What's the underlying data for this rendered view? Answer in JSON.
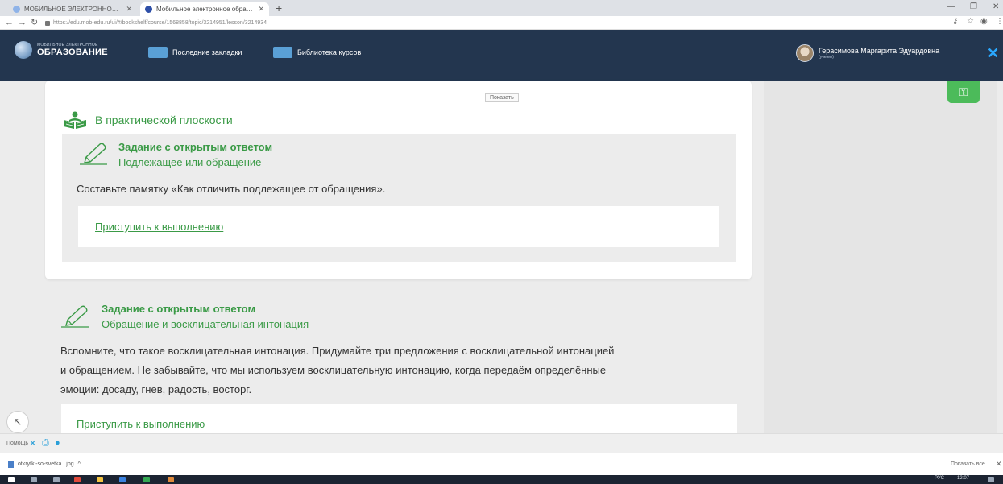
{
  "browser": {
    "tabs": [
      {
        "title": "МОБИЛЬНОЕ ЭЛЕКТРОННОЕ ОБРАЗОВАНИЕ",
        "active": false,
        "favicon_color": "#8fb3e8"
      },
      {
        "title": "Мобильное электронное образование",
        "active": true,
        "favicon_color": "#2e4fa8"
      }
    ],
    "new_tab": "+",
    "url": "https://edu.mob-edu.ru/ui/#/bookshelf/course/1568858/topic/3214951/lesson/3214934"
  },
  "header": {
    "logo_small": "МОБИЛЬНОЕ ЭЛЕКТРОННОЕ",
    "logo_big": "ОБРАЗОВАНИЕ",
    "nav": [
      {
        "label": "Последние закладки",
        "icon": "bookmarks-icon"
      },
      {
        "label": "Библиотека курсов",
        "icon": "library-icon"
      }
    ],
    "user_name": "Герасимова Маргарита Эдуардовна",
    "user_role": "(ученик)",
    "close": "✕"
  },
  "content": {
    "show_button": "Показать",
    "section_title": "В практической плоскости",
    "task1": {
      "label": "Задание с открытым ответом",
      "subtitle": "Подлежащее или обращение",
      "body": "Составьте памятку «Как отличить подлежащее от обращения».",
      "action": "Приступить к выполнению"
    },
    "task2": {
      "label": "Задание с открытым ответом",
      "subtitle": "Обращение и восклицательная интонация",
      "body_lines": [
        "Вспомните, что такое восклицательная интонация. Придумайте три предложения с восклицательной интонацией",
        "и обращением. Не забывайте, что мы используем восклицательную интонацию, когда передаём определённые",
        "эмоции: досаду, гнев, радость, восторг."
      ],
      "action": "Приступить к выполнению"
    }
  },
  "help_bar": {
    "label": "Помощь"
  },
  "downloads": {
    "file": "otkrytki-so-svetka...jpg",
    "show_all": "Показать все",
    "close": "✕"
  },
  "taskbar": {
    "lang": "РУС",
    "time": "12:07"
  },
  "colors": {
    "accent_green": "#3a9a46",
    "header_bg": "#23364f",
    "key_button": "#4cbb5a"
  }
}
